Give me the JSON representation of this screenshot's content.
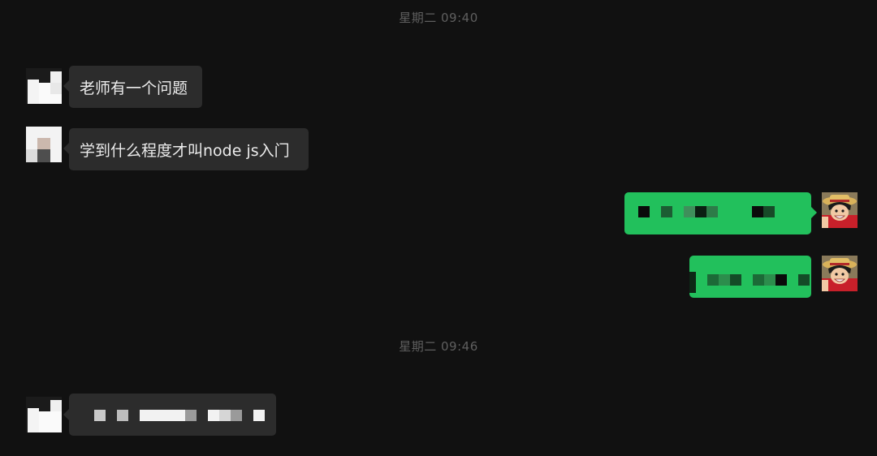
{
  "timestamps": [
    "星期二 09:40",
    "星期二 09:46"
  ],
  "messages": [
    {
      "side": "incoming",
      "text": "老师有一个问题"
    },
    {
      "side": "incoming",
      "text": "学到什么程度才叫node js入门"
    },
    {
      "side": "outgoing",
      "text": ""
    },
    {
      "side": "outgoing",
      "text": ""
    },
    {
      "side": "incoming",
      "text": ""
    }
  ],
  "colors": {
    "background": "#111111",
    "incoming_bubble": "#2c2c2c",
    "outgoing_bubble": "#22c05c",
    "timestamp": "#5f5f5f"
  },
  "icons": {
    "contact_avatar": "pixelated-avatar-icon",
    "own_avatar": "anime-character-avatar-icon"
  }
}
